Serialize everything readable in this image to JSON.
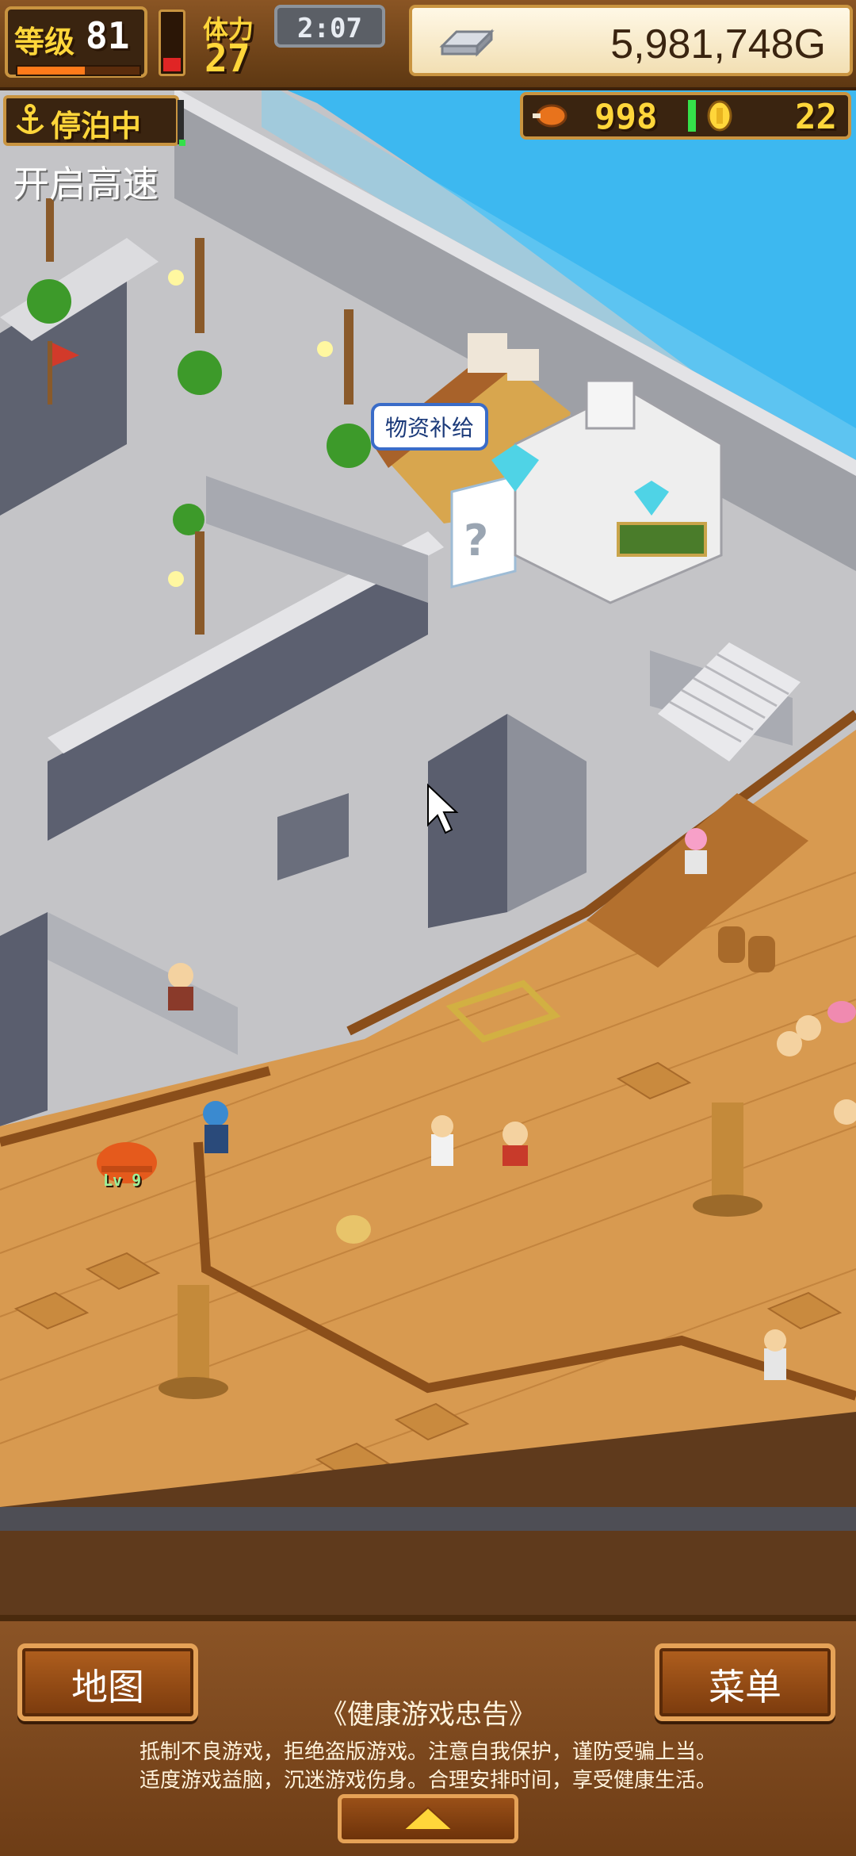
{
  "hud": {
    "level_label": "等级",
    "level_value": "81",
    "level_progress": 0.55,
    "stamina_label": "体力",
    "stamina_value": "27",
    "stamina_fill": 0.3,
    "time": "2:07",
    "money": "5,981,748G",
    "status_label": "停泊中",
    "speed_button": "开启高速",
    "food_value": "998",
    "coin_value": "22"
  },
  "scene": {
    "shop_label": "物资补给",
    "pet_level": "Lv 9"
  },
  "bottom": {
    "map_button": "地图",
    "menu_button": "菜单",
    "advisory_title": "《健康游戏忠告》",
    "advisory_line_1": "抵制不良游戏，拒绝盗版游戏。注意自我保护，谨防受骗上当。",
    "advisory_line_2": "适度游戏益脑，沉迷游戏伤身。合理安排时间，享受健康生活。"
  },
  "colors": {
    "sea": "#3db8f0",
    "stone": "#c7c7ca",
    "deck": "#d89a50",
    "hud_gold": "#ffd63a",
    "panel_wood": "#8b5426"
  },
  "icons": [
    "anchor-icon",
    "silver-bar-icon",
    "food-icon",
    "coin-icon",
    "expand-arrow-icon",
    "cursor-icon"
  ]
}
